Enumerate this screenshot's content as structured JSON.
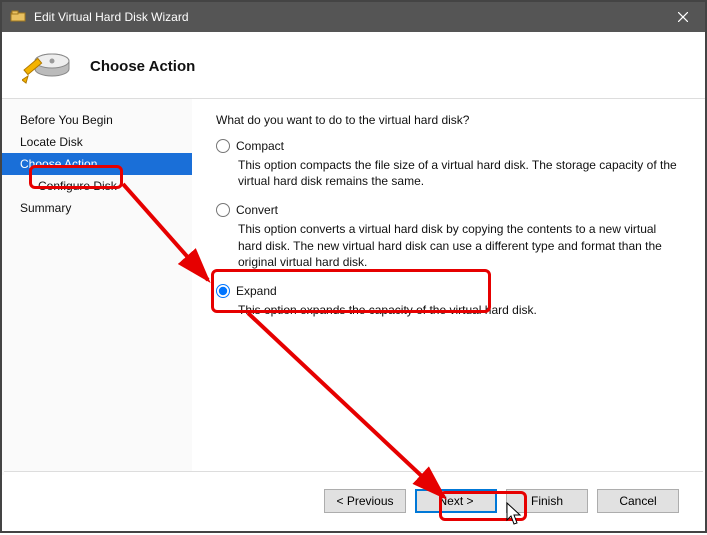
{
  "titlebar": {
    "title": "Edit Virtual Hard Disk Wizard"
  },
  "header": {
    "heading": "Choose Action"
  },
  "sidebar": {
    "items": [
      {
        "label": "Before You Begin",
        "selected": false,
        "indent": false
      },
      {
        "label": "Locate Disk",
        "selected": false,
        "indent": false
      },
      {
        "label": "Choose Action",
        "selected": true,
        "indent": false
      },
      {
        "label": "Configure Disk",
        "selected": false,
        "indent": true
      },
      {
        "label": "Summary",
        "selected": false,
        "indent": false
      }
    ]
  },
  "content": {
    "question": "What do you want to do to the virtual hard disk?",
    "options": [
      {
        "label": "Compact",
        "desc": "This option compacts the file size of a virtual hard disk. The storage capacity of the virtual hard disk remains the same.",
        "checked": false
      },
      {
        "label": "Convert",
        "desc": "This option converts a virtual hard disk by copying the contents to a new virtual hard disk. The new virtual hard disk can use a different type and format than the original virtual hard disk.",
        "checked": false
      },
      {
        "label": "Expand",
        "desc": "This option expands the capacity of the virtual hard disk.",
        "checked": true
      }
    ]
  },
  "footer": {
    "previous": "< Previous",
    "next": "Next >",
    "finish": "Finish",
    "cancel": "Cancel"
  }
}
